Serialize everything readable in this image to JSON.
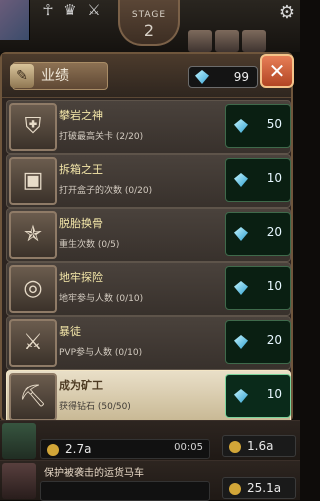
{
  "top": {
    "stage_label": "STAGE",
    "stage_number": "2"
  },
  "achievements": {
    "title": "业绩",
    "diamond_count": "99",
    "close_label": "✕",
    "items": [
      {
        "name": "攀岩之神",
        "desc": "打破最高关卡 (2/20)",
        "reward": "50",
        "icon": "shield-icon",
        "state": "in-progress"
      },
      {
        "name": "拆箱之王",
        "desc": "打开盒子的次数 (0/20)",
        "reward": "10",
        "icon": "treasure-box-icon",
        "state": "in-progress"
      },
      {
        "name": "脱胎换骨",
        "desc": "重生次数 (0/5)",
        "reward": "20",
        "icon": "pentagram-icon",
        "state": "in-progress"
      },
      {
        "name": "地牢探险",
        "desc": "地牢参与人数 (0/10)",
        "reward": "10",
        "icon": "portal-icon",
        "state": "in-progress"
      },
      {
        "name": "暴徒",
        "desc": "PVP参与人数 (0/10)",
        "reward": "20",
        "icon": "crossed-swords-icon",
        "state": "in-progress"
      },
      {
        "name": "成为矿工",
        "desc": "获得钻石 (50/50)",
        "reward": "10",
        "icon": "miner-icon",
        "state": "completed"
      }
    ]
  },
  "background_list": {
    "row1": {
      "left_value": "2.7a",
      "timer": "00:05",
      "right_value": "1.6a"
    },
    "row2": {
      "text": "保护被袭击的运货马车",
      "right_value": "25.1a"
    }
  },
  "colors": {
    "panel_border": "#6f563c",
    "reward_bg": "#0a1f12",
    "close_button": "#c1582f"
  }
}
